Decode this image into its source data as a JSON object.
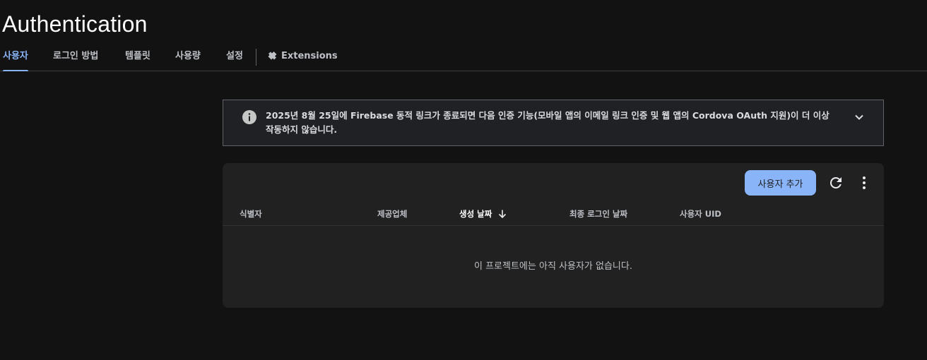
{
  "page": {
    "title": "Authentication"
  },
  "tabs": {
    "users": "사용자",
    "sign_in_method": "로그인 방법",
    "templates": "템플릿",
    "usage": "사용량",
    "settings": "설정",
    "extensions": "Extensions",
    "active": "users"
  },
  "notice": {
    "text_line1": "2025년 8월 25일에 Firebase 동적 링크가 종료되면 다음 인증 기능(모바일 앱의 이메일 링크 인증 및 웹 앱의 Cordova OAuth 지원)이 더 이상",
    "text_line2": "작동하지 않습니다.",
    "icon": "info-icon",
    "expand_icon": "chevron-down-icon"
  },
  "users_table": {
    "add_user_label": "사용자 추가",
    "refresh_icon": "refresh-icon",
    "more_icon": "more-vert-icon",
    "columns": [
      "식별자",
      "제공업체",
      "생성 날짜",
      "최종 로그인 날짜",
      "사용자 UID"
    ],
    "sorted_column": "생성 날짜",
    "sort_direction": "descending",
    "empty_message": "이 프로젝트에는 아직 사용자가 없습니다."
  },
  "colors": {
    "accent": "#8ab4f8",
    "background": "#121212",
    "card": "#212121"
  }
}
